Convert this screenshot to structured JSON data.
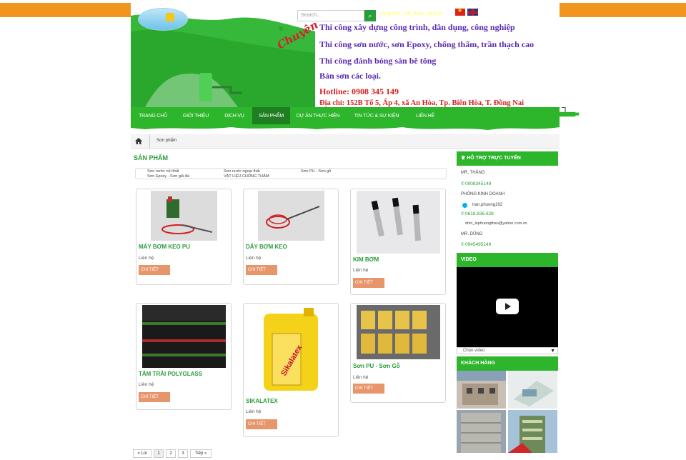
{
  "search": {
    "placeholder": "Search..."
  },
  "toplinks": [
    "Trang chủ",
    "Giới thiệu",
    "Dịch vụ"
  ],
  "banner": {
    "chuyen": "Chuyên",
    "lines": [
      "Thi công xây dựng công trình, dân dụng, công nghiệp",
      "Thi công sơn nước, sơn Epoxy, chống thấm, trần thạch cao",
      "Thi công đánh bóng sàn bê tông",
      "Bán sơn các loại."
    ],
    "hotline": "Hotline: 0908 345 149",
    "address": "Địa chỉ: 152B Tổ 5, Ấp 4, xã An Hòa, Tp. Biên Hòa, T. Đồng Nai"
  },
  "nav": [
    "TRANG CHỦ",
    "GIỚI THIỆU",
    "DỊCH VỤ",
    "SẢN PHẨM",
    "DỰ ÁN THỰC HIỆN",
    "TIN TỨC & SỰ KIỆN",
    "LIÊN HỆ"
  ],
  "breadcrumb": {
    "current": "Sơn phẩm"
  },
  "section_title": "SẢN PHẨM",
  "categories": [
    "Sơn nước nội thất",
    "Sơn nước ngoại thất",
    "Sơn PU - Sơn gỗ",
    "Sơn Epoxy - Sơn giả đá",
    "VẬT LIỆU CHỐNG THẤM"
  ],
  "products": [
    {
      "name": "MÁY BƠM KEO PU",
      "price": "Liên hệ",
      "button": "CHI TIẾT"
    },
    {
      "name": "DÂY BƠM KEO",
      "price": "Liên hệ",
      "button": "CHI TIẾT"
    },
    {
      "name": "KIM BƠM",
      "price": "Liên hệ",
      "button": "CHI TIẾT"
    },
    {
      "name": "TẤM TRẢI POLYGLASS",
      "price": "Liên hệ",
      "button": "CHI TIẾT"
    },
    {
      "name": "SIKALATEX",
      "price": "Liên hệ",
      "button": "CHI TIẾT"
    },
    {
      "name": "Sơn PU - Sơn Gỗ",
      "price": "Liên hệ",
      "button": "CHI TIẾT"
    }
  ],
  "pager": {
    "prev": "« Lùi",
    "pages": [
      "1",
      "2",
      "3"
    ],
    "next": "Tiếp »"
  },
  "sidebar": {
    "support_title": "HỖ TRỢ TRỰC TUYẾN",
    "contacts": [
      {
        "name": "MR. THẮNG",
        "phone": "0908345149"
      },
      {
        "name": "PHÒNG KINH DOANH",
        "skype": "tran.phuong192",
        "phone": "0618.836.628",
        "email": "dnin_lephuongthao@yahoo.com.vn"
      },
      {
        "name": "MR. DŨNG",
        "phone": "0945495249"
      }
    ],
    "video_title": "VIDEO",
    "video_select": "Chọn video",
    "clients_title": "KHÁCH HÀNG"
  },
  "colors": {
    "orange": "#f0961e",
    "green": "#2db52c",
    "dark_green": "#1f7d22",
    "button": "#e7956a",
    "purple": "#5b2ab3",
    "red": "#d62020"
  }
}
